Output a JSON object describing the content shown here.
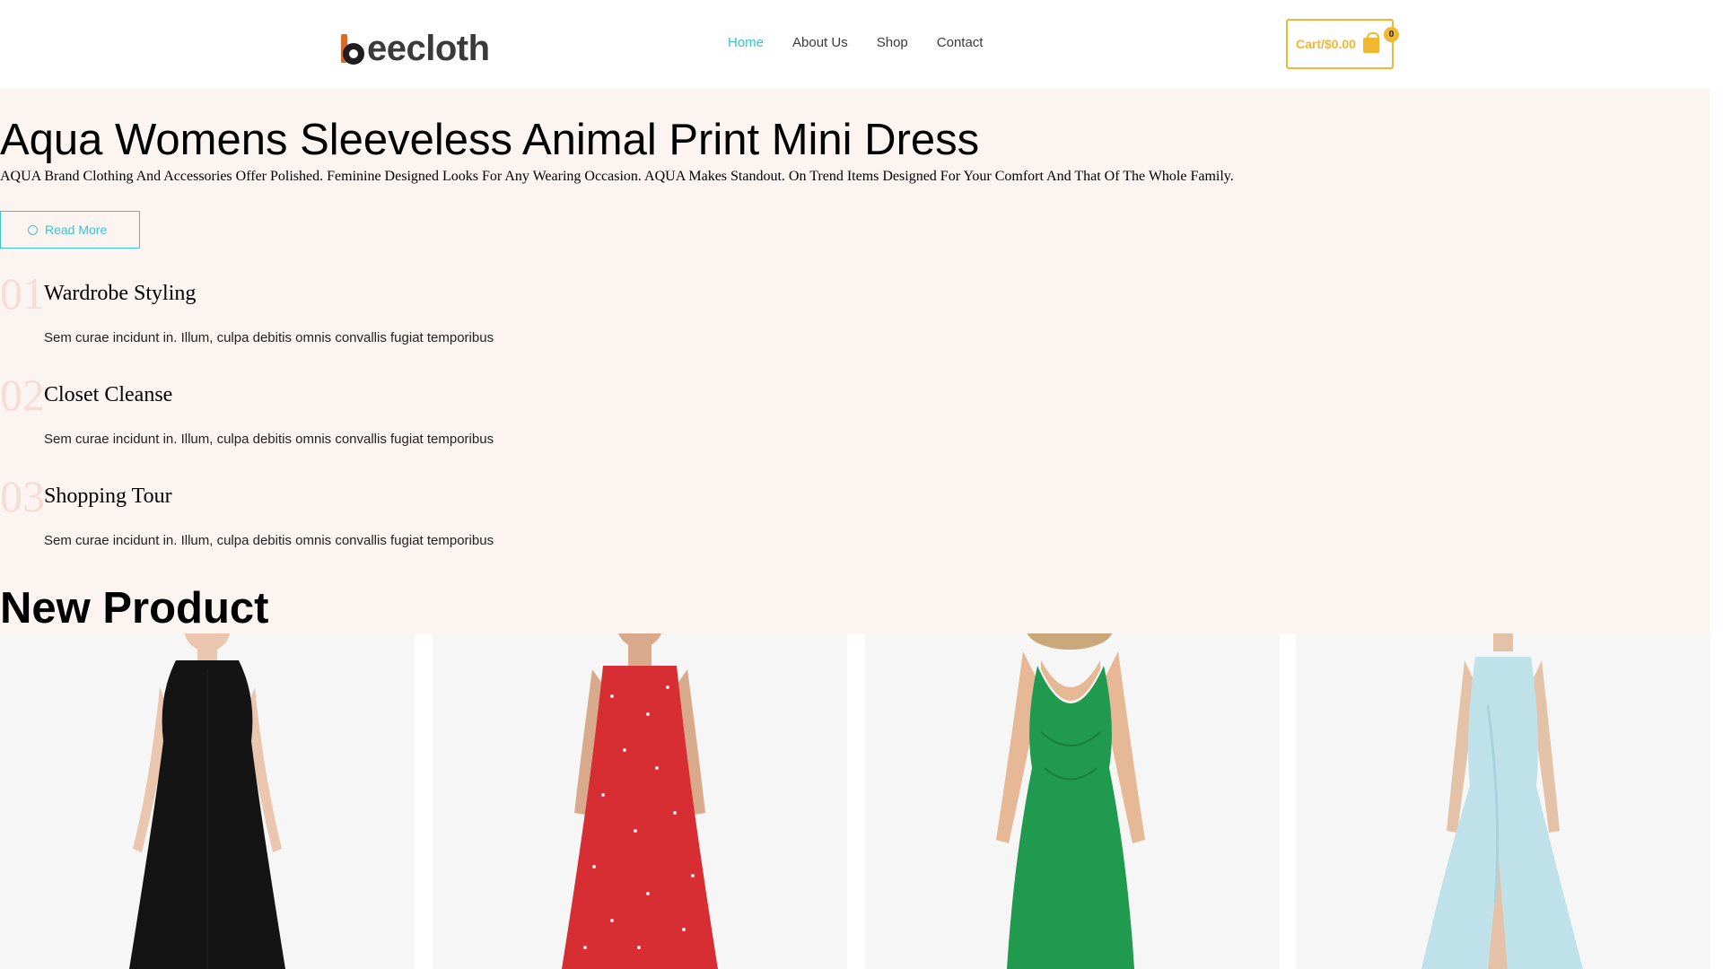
{
  "header": {
    "logo_text": "eecloth",
    "nav": [
      {
        "label": "Home",
        "active": true
      },
      {
        "label": "About Us",
        "active": false
      },
      {
        "label": "Shop",
        "active": false
      },
      {
        "label": "Contact",
        "active": false
      }
    ],
    "cart": {
      "label": "Cart/$0.00",
      "count": "0"
    }
  },
  "hero": {
    "title": "Aqua Womens Sleeveless Animal Print Mini Dress",
    "description": "AQUA Brand Clothing And Accessories Offer Polished. Feminine Designed Looks For Any Wearing Occasion. AQUA Makes Standout. On Trend Items Designed For Your Comfort And That Of The Whole Family.",
    "button_label": "Read More"
  },
  "features": [
    {
      "number": "01",
      "title": "Wardrobe Styling",
      "description": "Sem curae incidunt in. Illum, culpa debitis omnis convallis fugiat temporibus"
    },
    {
      "number": "02",
      "title": "Closet Cleanse",
      "description": "Sem curae incidunt in. Illum, culpa debitis omnis convallis fugiat temporibus"
    },
    {
      "number": "03",
      "title": "Shopping Tour",
      "description": "Sem curae incidunt in. Illum, culpa debitis omnis convallis fugiat temporibus"
    }
  ],
  "new_products": {
    "title": "New Product",
    "items": [
      {
        "name": "black-dress",
        "color": "#141414"
      },
      {
        "name": "red-floral-dress",
        "color": "#d72e33"
      },
      {
        "name": "green-dress",
        "color": "#1f9a4e"
      },
      {
        "name": "aqua-satin-dress",
        "color": "#bfe2ea"
      }
    ]
  },
  "colors": {
    "accent": "#34c6d8",
    "cart": "#f2b630",
    "hero_bg": "#fcf4f1",
    "number": "#f4ddd6"
  }
}
